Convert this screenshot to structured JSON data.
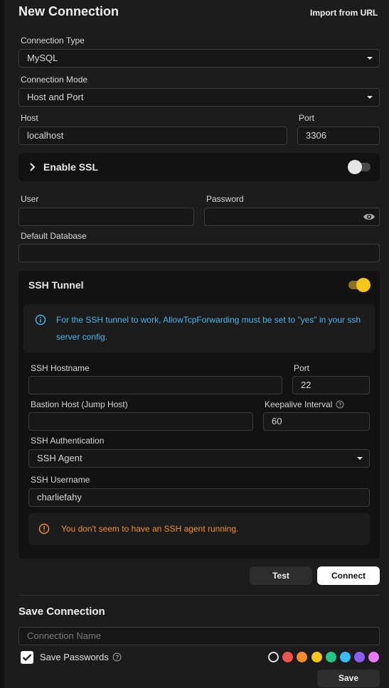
{
  "header": {
    "title": "New Connection",
    "import_label": "Import from URL"
  },
  "connection": {
    "type_label": "Connection Type",
    "type_value": "MySQL",
    "mode_label": "Connection Mode",
    "mode_value": "Host and Port",
    "host_label": "Host",
    "host_value": "localhost",
    "port_label": "Port",
    "port_value": "3306",
    "ssl_label": "Enable SSL",
    "ssl_enabled": false,
    "user_label": "User",
    "user_value": "",
    "password_label": "Password",
    "password_value": "",
    "db_label": "Default Database",
    "db_value": ""
  },
  "ssh": {
    "title": "SSH Tunnel",
    "enabled": true,
    "info_text": "For the SSH tunnel to work, AllowTcpForwarding must be set to \"yes\" in your ssh server config.",
    "hostname_label": "SSH Hostname",
    "hostname_value": "",
    "port_label": "Port",
    "port_value": "22",
    "bastion_label": "Bastion Host (Jump Host)",
    "bastion_value": "",
    "keepalive_label": "Keepalive Interval",
    "keepalive_value": "60",
    "auth_label": "SSH Authentication",
    "auth_value": "SSH Agent",
    "username_label": "SSH Username",
    "username_value": "charliefahy",
    "warning_text": "You don't seem to have an SSH agent running."
  },
  "actions": {
    "test_label": "Test",
    "connect_label": "Connect"
  },
  "save": {
    "title": "Save Connection",
    "name_placeholder": "Connection Name",
    "save_passwords_label": "Save Passwords",
    "save_passwords_checked": true,
    "save_label": "Save"
  },
  "colors": {
    "accent_yellow": "#f5c518",
    "info_blue": "#4fb3e8",
    "warning_orange": "#f0902a",
    "palette": [
      "#1c1c1c",
      "#ef5350",
      "#f58c2a",
      "#f5c518",
      "#22c58a",
      "#38bdf8",
      "#8b5cf6",
      "#e879f9"
    ]
  }
}
